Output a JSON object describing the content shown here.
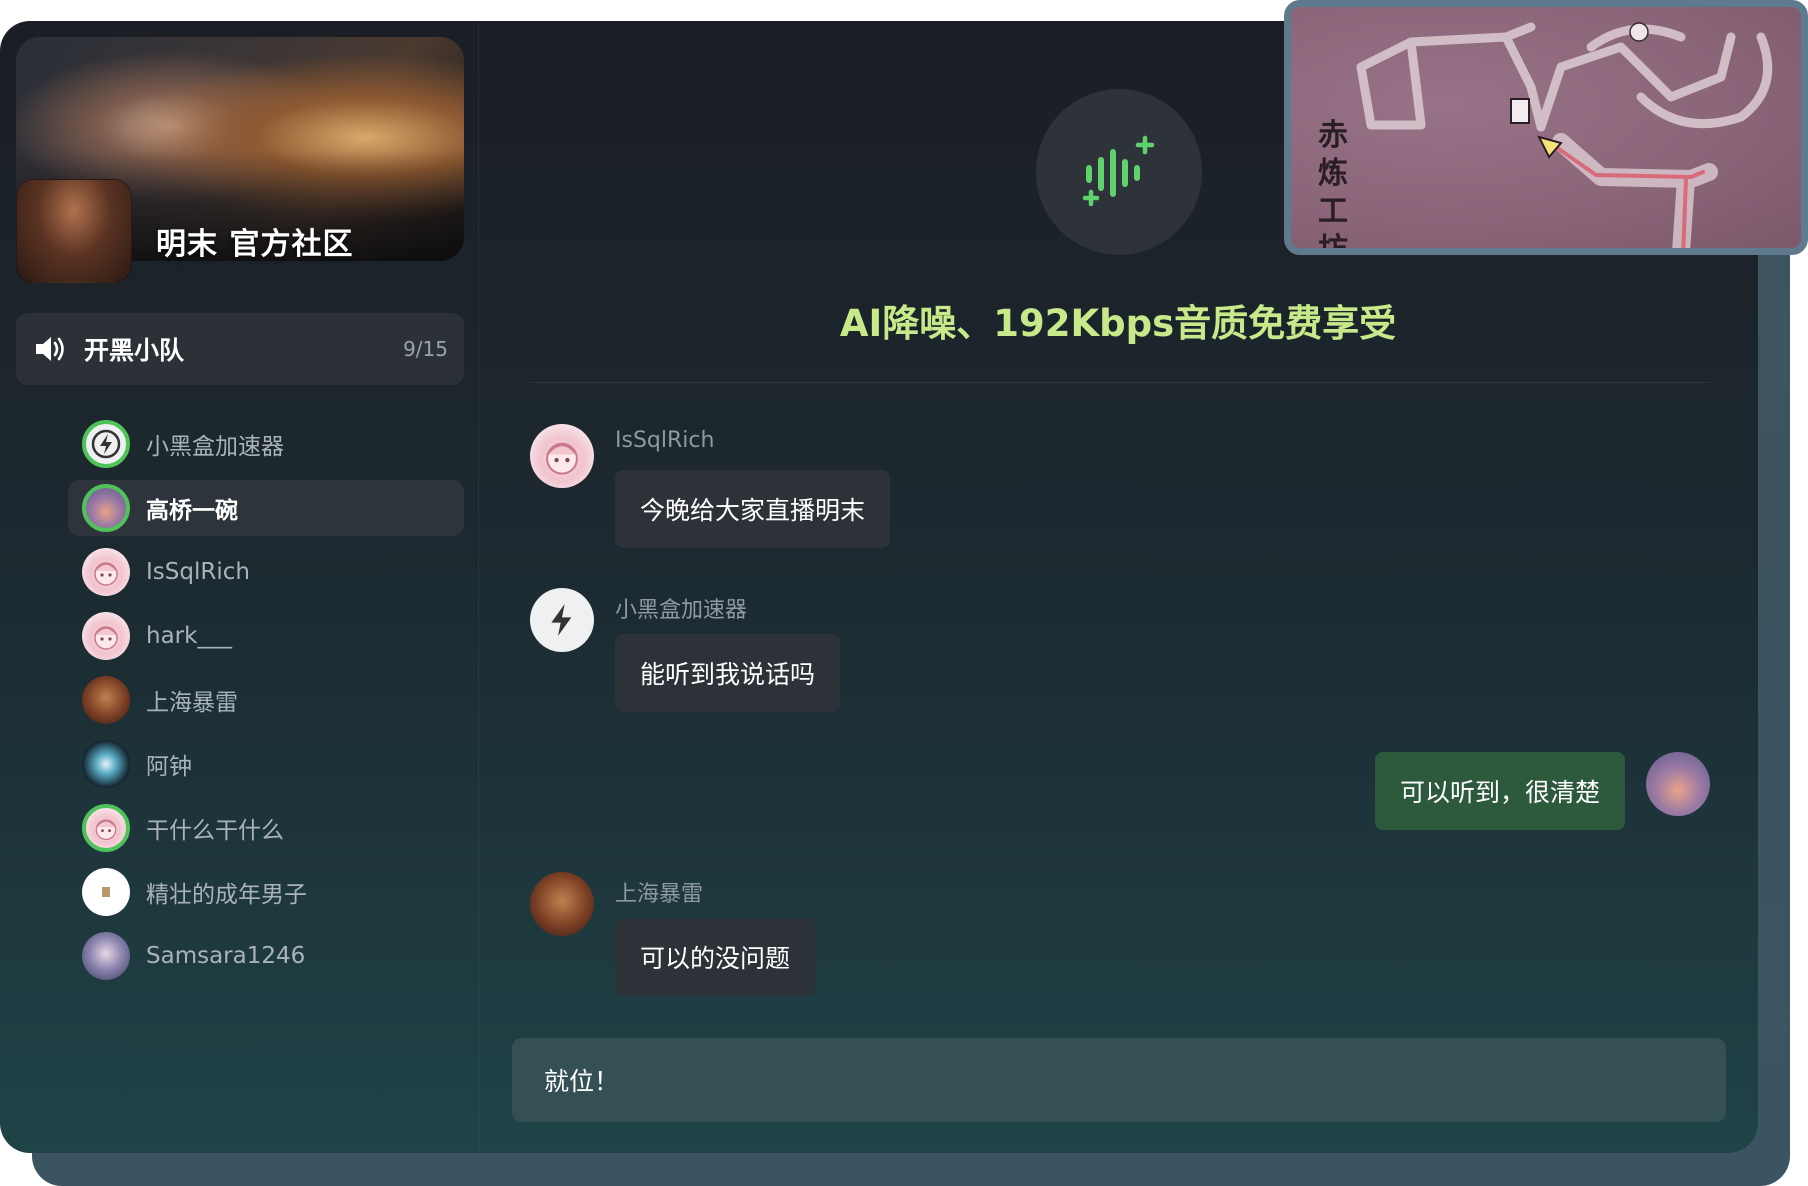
{
  "community": {
    "title": "明末 官方社区"
  },
  "channel": {
    "name": "开黑小队",
    "count": "9/15",
    "icon": "speaker-icon"
  },
  "members": [
    {
      "name": "小黑盒加速器",
      "avatar": "bolt",
      "speaking": true,
      "active": false
    },
    {
      "name": "高桥一碗",
      "avatar": "sunset",
      "speaking": true,
      "active": true
    },
    {
      "name": "IsSqlRich",
      "avatar": "anime",
      "speaking": false,
      "active": false
    },
    {
      "name": "hark___",
      "avatar": "anime",
      "speaking": false,
      "active": false
    },
    {
      "name": "上海暴雷",
      "avatar": "man",
      "speaking": false,
      "active": false
    },
    {
      "name": "阿钟",
      "avatar": "knight",
      "speaking": false,
      "active": false
    },
    {
      "name": "干什么干什么",
      "avatar": "anime",
      "speaking": true,
      "active": false
    },
    {
      "name": "精壮的成年男子",
      "avatar": "white",
      "speaking": false,
      "active": false
    },
    {
      "name": "Samsara1246",
      "avatar": "sam",
      "speaking": false,
      "active": false
    }
  ],
  "promo": {
    "text": "AI降噪、192Kbps音质免费享受",
    "icon": "ai-voice-icon"
  },
  "messages": [
    {
      "sender": "IsSqlRich",
      "text": "今晚给大家直播明末",
      "mine": false
    },
    {
      "sender": "小黑盒加速器",
      "text": "能听到我说话吗",
      "mine": false
    },
    {
      "sender": "",
      "text": "可以听到，很清楚",
      "mine": true
    },
    {
      "sender": "上海暴雷",
      "text": "可以的没问题",
      "mine": false
    }
  ],
  "composer": {
    "value": "就位！"
  },
  "minimap": {
    "label": [
      "赤",
      "炼",
      "工",
      "坊"
    ]
  },
  "colors": {
    "accent_green": "#4fc25b",
    "promo_text": "#c7e98a",
    "my_bubble": "#2d5a3d",
    "bubble": "#2d3239"
  }
}
